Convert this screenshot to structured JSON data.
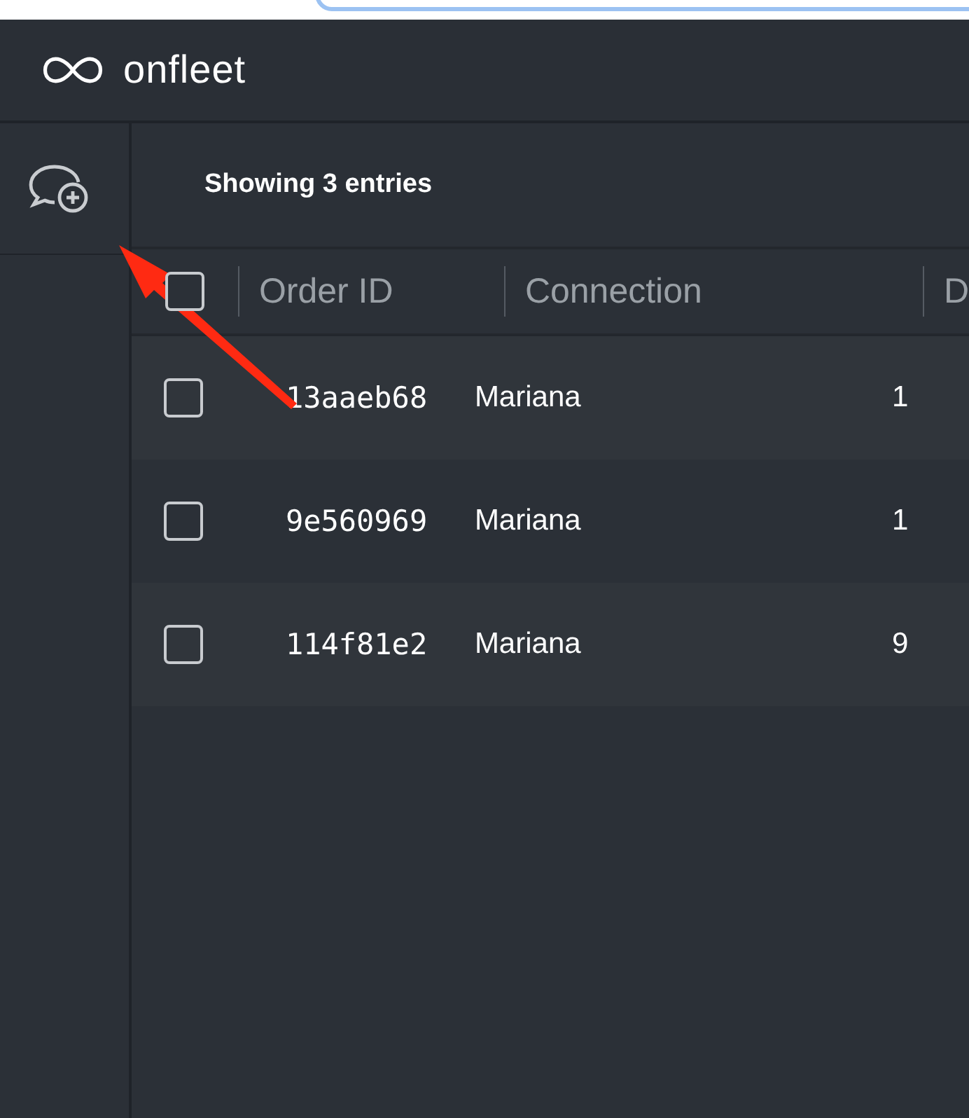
{
  "header": {
    "logo_text": "onfleet"
  },
  "summary": "Showing 3 entries",
  "table": {
    "select_all": {
      "checked": false
    },
    "columns": [
      "Order ID",
      "Connection",
      "D"
    ],
    "rows": [
      {
        "checked": false,
        "order_id": "13aaeb68",
        "connection": "Mariana",
        "column_3": "1"
      },
      {
        "checked": false,
        "order_id": "9e560969",
        "connection": "Mariana",
        "column_3": "1"
      },
      {
        "checked": false,
        "order_id": "114f81e2",
        "connection": "Mariana",
        "column_3": "9"
      }
    ]
  }
}
